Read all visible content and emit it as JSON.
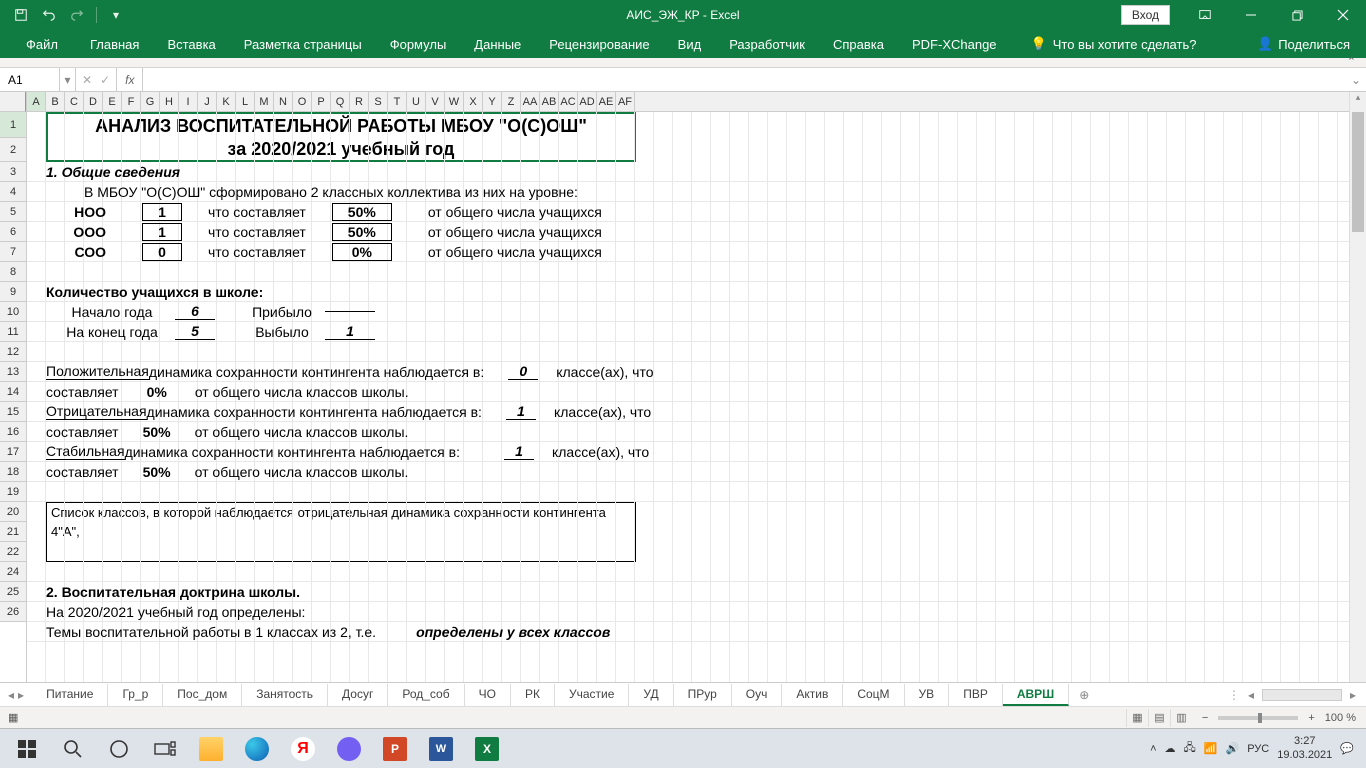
{
  "titlebar": {
    "title": "АИС_ЭЖ_КР - Excel",
    "login": "Вход"
  },
  "ribbon": {
    "tabs": [
      "Файл",
      "Главная",
      "Вставка",
      "Разметка страницы",
      "Формулы",
      "Данные",
      "Рецензирование",
      "Вид",
      "Разработчик",
      "Справка",
      "PDF-XChange"
    ],
    "search": "Что вы хотите сделать?",
    "share": "Поделиться"
  },
  "namebox": "A1",
  "fx": "fx",
  "cols": [
    "A",
    "B",
    "C",
    "D",
    "E",
    "F",
    "G",
    "H",
    "I",
    "J",
    "K",
    "L",
    "M",
    "N",
    "O",
    "P",
    "Q",
    "R",
    "S",
    "T",
    "U",
    "V",
    "W",
    "X",
    "Y",
    "Z",
    "AA",
    "AB",
    "AC",
    "AD",
    "AE",
    "AF"
  ],
  "rows": [
    "1",
    "2",
    "3",
    "4",
    "5",
    "6",
    "7",
    "8",
    "9",
    "10",
    "11",
    "12",
    "13",
    "14",
    "15",
    "16",
    "17",
    "18",
    "19",
    "20",
    "21",
    "22",
    "24",
    "25",
    "26"
  ],
  "doc": {
    "title1": "АНАЛИЗ ВОСПИТАТЕЛЬНОЙ РАБОТЫ МБОУ \"О(С)ОШ\"",
    "title2": "за 2020/2021 учебный год",
    "h1": "1. Общие сведения",
    "intro": "В МБОУ \"О(С)ОШ\" сформировано 2 классных коллектива из них на уровне:",
    "noo": "НОО",
    "ooo": "ООО",
    "soo": "СОО",
    "v_noo": "1",
    "v_ooo": "1",
    "v_soo": "0",
    "makes": "что составляет",
    "p_noo": "50%",
    "p_ooo": "50%",
    "p_soo": "0%",
    "of_total": "от общего числа учащихся",
    "count_h": "Количество учащихся в школе:",
    "start": "Начало года",
    "start_v": "6",
    "arr": "Прибыло",
    "arr_v": "",
    "end": "На конец года",
    "end_v": "5",
    "dep": "Выбыло",
    "dep_v": "1",
    "pos": "Положительная",
    "dyn_txt": " динамика сохранности контингента наблюдается в:",
    "neg": "Отрицательная",
    "stab": "Стабильная",
    "cls0": "0",
    "cls1": "1",
    "cls1b": "1",
    "cls_sfx": "классе(ах), что",
    "sost": "составляет",
    "p50": "50%",
    "p0": "0%",
    "of_classes": "от общего числа классов школы.",
    "list_h": "Список классов, в которой наблюдается отрицательная динамика сохранности контингента",
    "list_v": "4\"А\",",
    "h2": "2. Воспитательная доктрина школы.",
    "r25": "На 2020/2021 учебный год определены:",
    "r26a": "Темы воспитательной работы в 1 классах из 2, т.е.",
    "r26b": "определены у всех классов"
  },
  "chart_data": {
    "type": "table",
    "title": "Сведения по уровням",
    "rows": [
      {
        "level": "НОО",
        "count": 1,
        "percent": "50%"
      },
      {
        "level": "ООО",
        "count": 1,
        "percent": "50%"
      },
      {
        "level": "СОО",
        "count": 0,
        "percent": "0%"
      }
    ],
    "students": {
      "start": 6,
      "end": 5,
      "arrived": null,
      "departed": 1
    },
    "dynamics": {
      "positive_classes": 0,
      "positive_pct": "0%",
      "negative_classes": 1,
      "negative_pct": "50%",
      "stable_classes": 1,
      "stable_pct": "50%"
    }
  },
  "sheets": [
    "Питание",
    "Гр_р",
    "Пос_дом",
    "Занятость",
    "Досуг",
    "Род_соб",
    "ЧО",
    "РК",
    "Участие",
    "УД",
    "ПРур",
    "Оуч",
    "Актив",
    "СоцМ",
    "УВ",
    "ПВР",
    "АВРШ"
  ],
  "active_sheet": "АВРШ",
  "status": {
    "zoom": "100 %"
  },
  "taskbar": {
    "lang": "РУС",
    "time": "3:27",
    "date": "19.03.2021"
  }
}
